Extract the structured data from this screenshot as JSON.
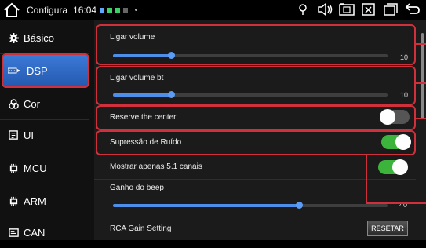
{
  "status": {
    "app_title": "Configura",
    "time": "16:04",
    "icons": [
      "home-icon",
      "location-icon",
      "volume-icon",
      "screenshot-icon",
      "close-window-icon",
      "recent-apps-icon",
      "back-icon"
    ]
  },
  "sidebar": {
    "items": [
      {
        "label": "Básico",
        "icon": "gear-icon"
      },
      {
        "label": "DSP",
        "icon": "dsp-icon",
        "active": true
      },
      {
        "label": "Cor",
        "icon": "color-icon"
      },
      {
        "label": "UI",
        "icon": "ui-icon"
      },
      {
        "label": "MCU",
        "icon": "chip-icon"
      },
      {
        "label": "ARM",
        "icon": "chip-icon"
      },
      {
        "label": "CAN",
        "icon": "can-icon"
      }
    ]
  },
  "settings": {
    "ligar_volume": {
      "label": "Ligar volume",
      "value": "10",
      "fraction": 0.21
    },
    "ligar_volume_bt": {
      "label": "Ligar volume bt",
      "value": "10",
      "fraction": 0.21
    },
    "reserve_center": {
      "label": "Reserve the center",
      "state": "off"
    },
    "supressao": {
      "label": "Supressão de Ruído",
      "state": "on"
    },
    "mostrar_51": {
      "label": "Mostrar apenas 5.1 canais",
      "state": "on"
    },
    "ganho_beep": {
      "label": "Ganho do beep",
      "value": "40",
      "fraction": 0.68
    },
    "rca_gain": {
      "label": "RCA Gain Setting",
      "button": "RESETAR"
    }
  },
  "colors": {
    "accent": "#4c8ee8",
    "toggle_on": "#3cb43c",
    "highlight": "#d0303b"
  }
}
